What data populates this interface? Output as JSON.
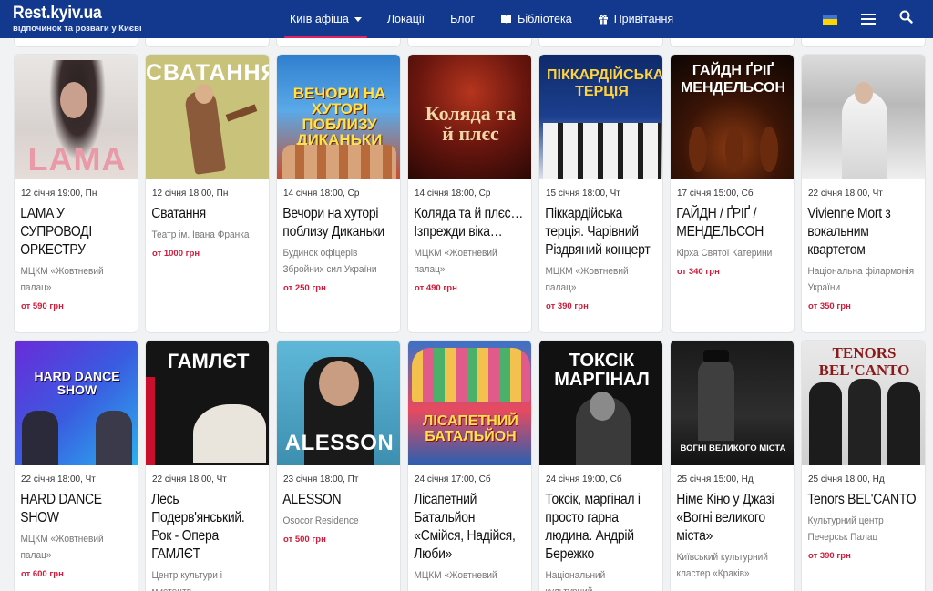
{
  "header": {
    "logo_title": "Rest.kyiv.ua",
    "logo_subtitle": "відпочинок та розваги у Києві",
    "nav": [
      "Київ афіша",
      "Локації",
      "Блог",
      "Бібліотека",
      "Привітання"
    ]
  },
  "colors": {
    "header_bg": "#13398f",
    "accent": "#e0245e",
    "price": "#d01c3c"
  },
  "cards": [
    {
      "poster_text": "LAMA",
      "date": "12 січня 19:00, Пн",
      "title_lines": [
        "LAMA У",
        "СУПРОВОДІ",
        "ОРКЕСТРУ"
      ],
      "venue_lines": [
        "МЦКМ «Жовтневий",
        "палац»"
      ],
      "price": "от 590 грн"
    },
    {
      "poster_text": "СВАТАННЯ",
      "date": "12 січня 18:00, Пн",
      "title_lines": [
        "Сватання"
      ],
      "venue_lines": [
        "Театр ім. Івана Франка"
      ],
      "price": "от 1000 грн"
    },
    {
      "poster_text": "ВЕЧОРИ НА ХУТОРІ ПОБЛИЗУ ДИКАНЬКИ",
      "date": "14 січня 18:00, Ср",
      "title_lines": [
        "Вечори на хуторі",
        "поблизу Диканьки"
      ],
      "venue_lines": [
        "Будинок офіцерів",
        "Збройних сил України"
      ],
      "price": "от 250 грн"
    },
    {
      "poster_text": "Коляда та й плєс",
      "date": "14 січня 18:00, Ср",
      "title_lines": [
        "Коляда та й плєс…",
        "Ізпрежди віка…"
      ],
      "venue_lines": [
        "МЦКМ «Жовтневий",
        "палац»"
      ],
      "price": "от 490 грн"
    },
    {
      "poster_text": "ПІККАРДІЙСЬКА ТЕРЦІЯ",
      "date": "15 січня 18:00, Чт",
      "title_lines": [
        "Піккардійська",
        "терція. Чарівний",
        "Різдвяний концерт"
      ],
      "venue_lines": [
        "МЦКМ «Жовтневий",
        "палац»"
      ],
      "price": "от 390 грн"
    },
    {
      "poster_text": "ГАЙДН ҐРІҐ МЕНДЕЛЬСОН",
      "date": "17 січня 15:00, Сб",
      "title_lines": [
        "ГАЙДН / ҐРІҐ /",
        "МЕНДЕЛЬСОН"
      ],
      "venue_lines": [
        "Кірха Святої Катерини"
      ],
      "price": "от 340 грн"
    },
    {
      "poster_text": "",
      "date": "22 січня 18:00, Чт",
      "title_lines": [
        "Vivienne Mort з",
        "вокальним",
        "квартетом"
      ],
      "venue_lines": [
        "Національна філармонія",
        "України"
      ],
      "price": "от 350 грн"
    },
    {
      "poster_text": "HARD DANCE SHOW",
      "date": "22 січня 18:00, Чт",
      "title_lines": [
        "HARD DANCE",
        "SHOW"
      ],
      "venue_lines": [
        "МЦКМ «Жовтневий",
        "палац»"
      ],
      "price": "от 600 грн"
    },
    {
      "poster_text": "ГАМЛЄТ",
      "date": "22 січня 18:00, Чт",
      "title_lines": [
        "Лесь",
        "Подерв'янський.",
        "Рок - Опера",
        "ГАМЛЄТ"
      ],
      "venue_lines": [
        "Центр культури і мистецтв"
      ],
      "price": ""
    },
    {
      "poster_text": "ALESSON",
      "date": "23 січня 18:00, Пт",
      "title_lines": [
        "ALESSON"
      ],
      "venue_lines": [
        "Osocor Residence"
      ],
      "price": "от 500 грн"
    },
    {
      "poster_text": "ЛІСАПЕТНИЙ БАТАЛЬЙОН",
      "date": "24 січня 17:00, Сб",
      "title_lines": [
        "Лісапетний",
        "Батальйон",
        "«Смійся, Надійся,",
        "Люби»"
      ],
      "venue_lines": [
        "МЦКМ «Жовтневий"
      ],
      "price": ""
    },
    {
      "poster_text": "ТОКСІК МАРГІНАЛ",
      "date": "24 січня 19:00, Сб",
      "title_lines": [
        "Токсік, маргінал і",
        "просто гарна",
        "людина. Андрій",
        "Бережко"
      ],
      "venue_lines": [
        "Національний культурний"
      ],
      "price": ""
    },
    {
      "poster_text": "ВОГНІ ВЕЛИКОГО МІСТА",
      "date": "25 січня 15:00, Нд",
      "title_lines": [
        "Німе Кіно у Джазі",
        "«Вогні великого",
        "міста»"
      ],
      "venue_lines": [
        "Київський культурний",
        "кластер «Краків»"
      ],
      "price": ""
    },
    {
      "poster_text": "TENORS BEL'CANTO",
      "date": "25 січня 18:00, Нд",
      "title_lines": [
        "Tenors BEL'CANTO"
      ],
      "venue_lines": [
        "Культурний центр",
        "Печерськ Палац"
      ],
      "price": "от 390 грн"
    }
  ]
}
